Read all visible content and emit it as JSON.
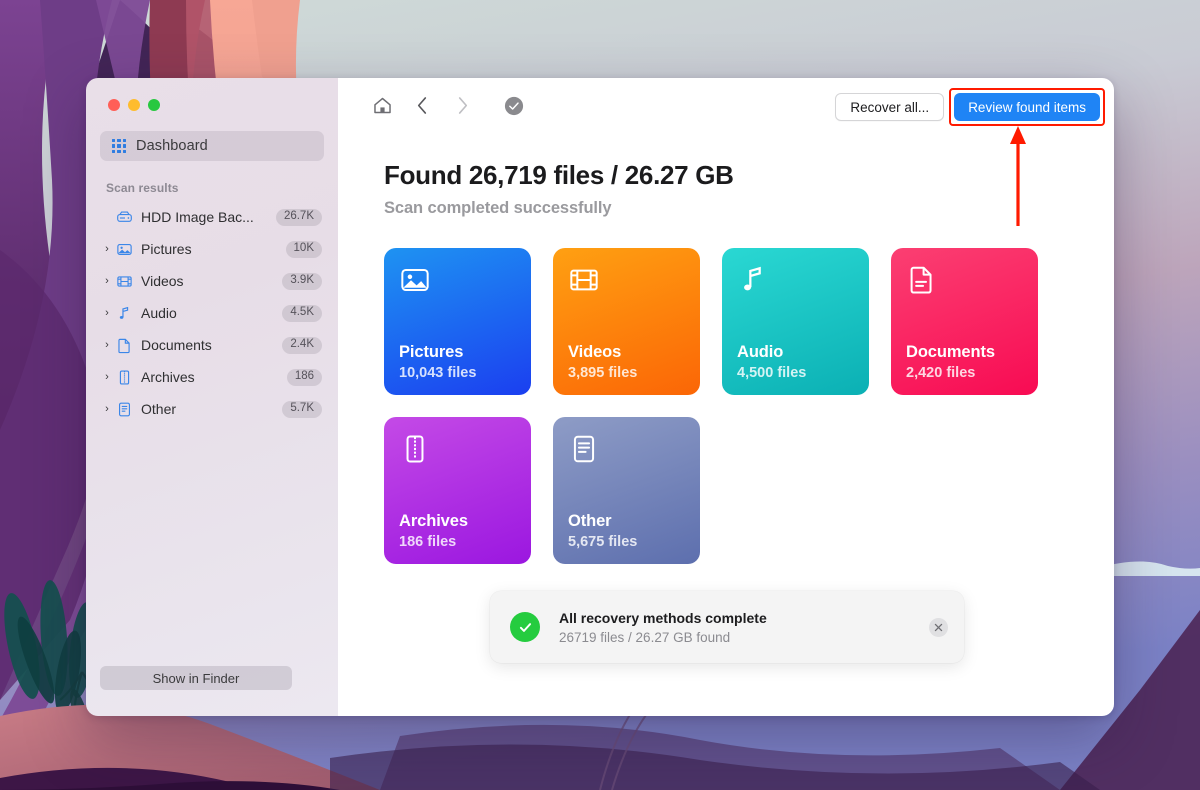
{
  "window": {
    "traffic_lights": [
      "close",
      "minimize",
      "maximize"
    ]
  },
  "sidebar": {
    "dashboard": {
      "label": "Dashboard",
      "icon": "grid-icon"
    },
    "section_title": "Scan results",
    "items": [
      {
        "label": "HDD Image Bac...",
        "badge": "26.7K",
        "icon": "hard-drive-icon",
        "expandable": false
      },
      {
        "label": "Pictures",
        "badge": "10K",
        "icon": "picture-icon",
        "expandable": true
      },
      {
        "label": "Videos",
        "badge": "3.9K",
        "icon": "film-icon",
        "expandable": true
      },
      {
        "label": "Audio",
        "badge": "4.5K",
        "icon": "music-note-icon",
        "expandable": true
      },
      {
        "label": "Documents",
        "badge": "2.4K",
        "icon": "document-icon",
        "expandable": true
      },
      {
        "label": "Archives",
        "badge": "186",
        "icon": "zip-icon",
        "expandable": true
      },
      {
        "label": "Other",
        "badge": "5.7K",
        "icon": "lines-doc-icon",
        "expandable": true
      }
    ],
    "show_in_finder_label": "Show in Finder"
  },
  "toolbar": {
    "home_icon": "home-icon",
    "back_icon": "chevron-left-icon",
    "forward_icon": "chevron-right-icon",
    "status_icon": "check-circle-icon",
    "recover_all_label": "Recover all...",
    "review_found_label": "Review found items",
    "review_found_accent": "#1f84f5",
    "highlight_color": "#ff1a00"
  },
  "main": {
    "title": "Found 26,719 files / 26.27 GB",
    "subtitle": "Scan completed successfully"
  },
  "cards": [
    {
      "title": "Pictures",
      "count": "10,043 files",
      "icon": "picture-icon",
      "color_from": "#1e93f2",
      "color_to": "#1b3ff0"
    },
    {
      "title": "Videos",
      "count": "3,895 files",
      "icon": "film-icon",
      "color_from": "#ffa012",
      "color_to": "#fb6606"
    },
    {
      "title": "Audio",
      "count": "4,500 files",
      "icon": "music-note-icon",
      "color_from": "#2ad8d3",
      "color_to": "#0bb0b4"
    },
    {
      "title": "Documents",
      "count": "2,420 files",
      "icon": "document-icon",
      "color_from": "#fb3f72",
      "color_to": "#f80b53"
    },
    {
      "title": "Archives",
      "count": "186 files",
      "icon": "zip-icon",
      "color_from": "#c44ae6",
      "color_to": "#9b17e0"
    },
    {
      "title": "Other",
      "count": "5,675 files",
      "icon": "lines-doc-icon",
      "color_from": "#8e9cc6",
      "color_to": "#5d6fae"
    }
  ],
  "toast": {
    "title": "All recovery methods complete",
    "subtitle": "26719 files / 26.27 GB found",
    "status_color": "#25cc3f",
    "close_icon": "close-icon"
  }
}
